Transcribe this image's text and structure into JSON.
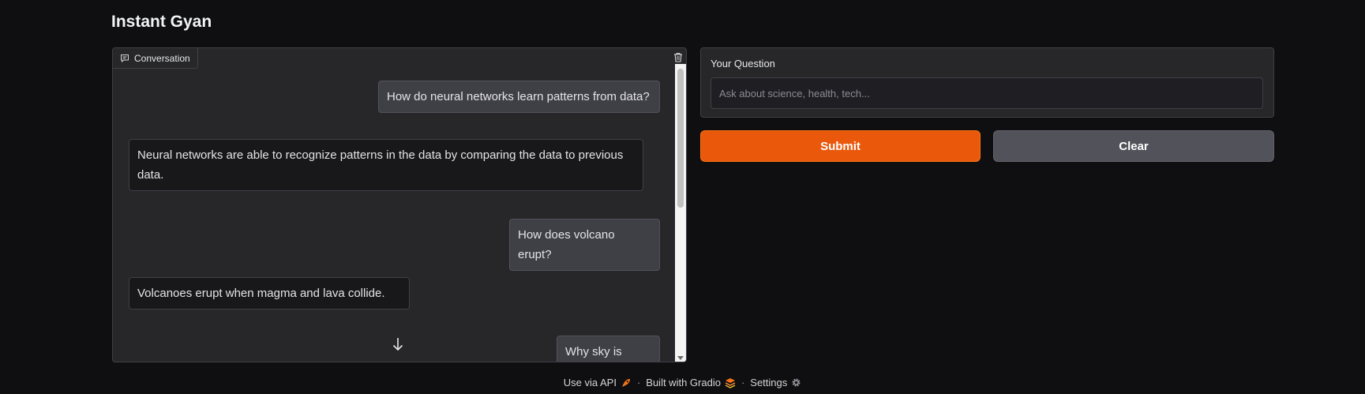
{
  "app": {
    "title": "Instant Gyan"
  },
  "chatbot": {
    "label": "Conversation",
    "messages": [
      {
        "role": "user",
        "text": "How do neural networks learn patterns from data?"
      },
      {
        "role": "bot",
        "text": "Neural networks are able to recognize patterns in the data by comparing the data to previous data."
      },
      {
        "role": "user",
        "text": "How does volcano erupt?"
      },
      {
        "role": "bot",
        "text": "Volcanoes erupt when magma and lava collide."
      },
      {
        "role": "user",
        "text": "Why sky is blue?"
      }
    ]
  },
  "question": {
    "label": "Your Question",
    "value": "",
    "placeholder": "Ask about science, health, tech..."
  },
  "buttons": {
    "submit_label": "Submit",
    "clear_label": "Clear"
  },
  "footer": {
    "api_label": "Use via API",
    "built_label": "Built with Gradio",
    "settings_label": "Settings",
    "separator": "·"
  },
  "colors": {
    "background": "#0f0f11",
    "panel": "#27272a",
    "accent": "#ea580c",
    "secondary_button": "#52525b"
  }
}
